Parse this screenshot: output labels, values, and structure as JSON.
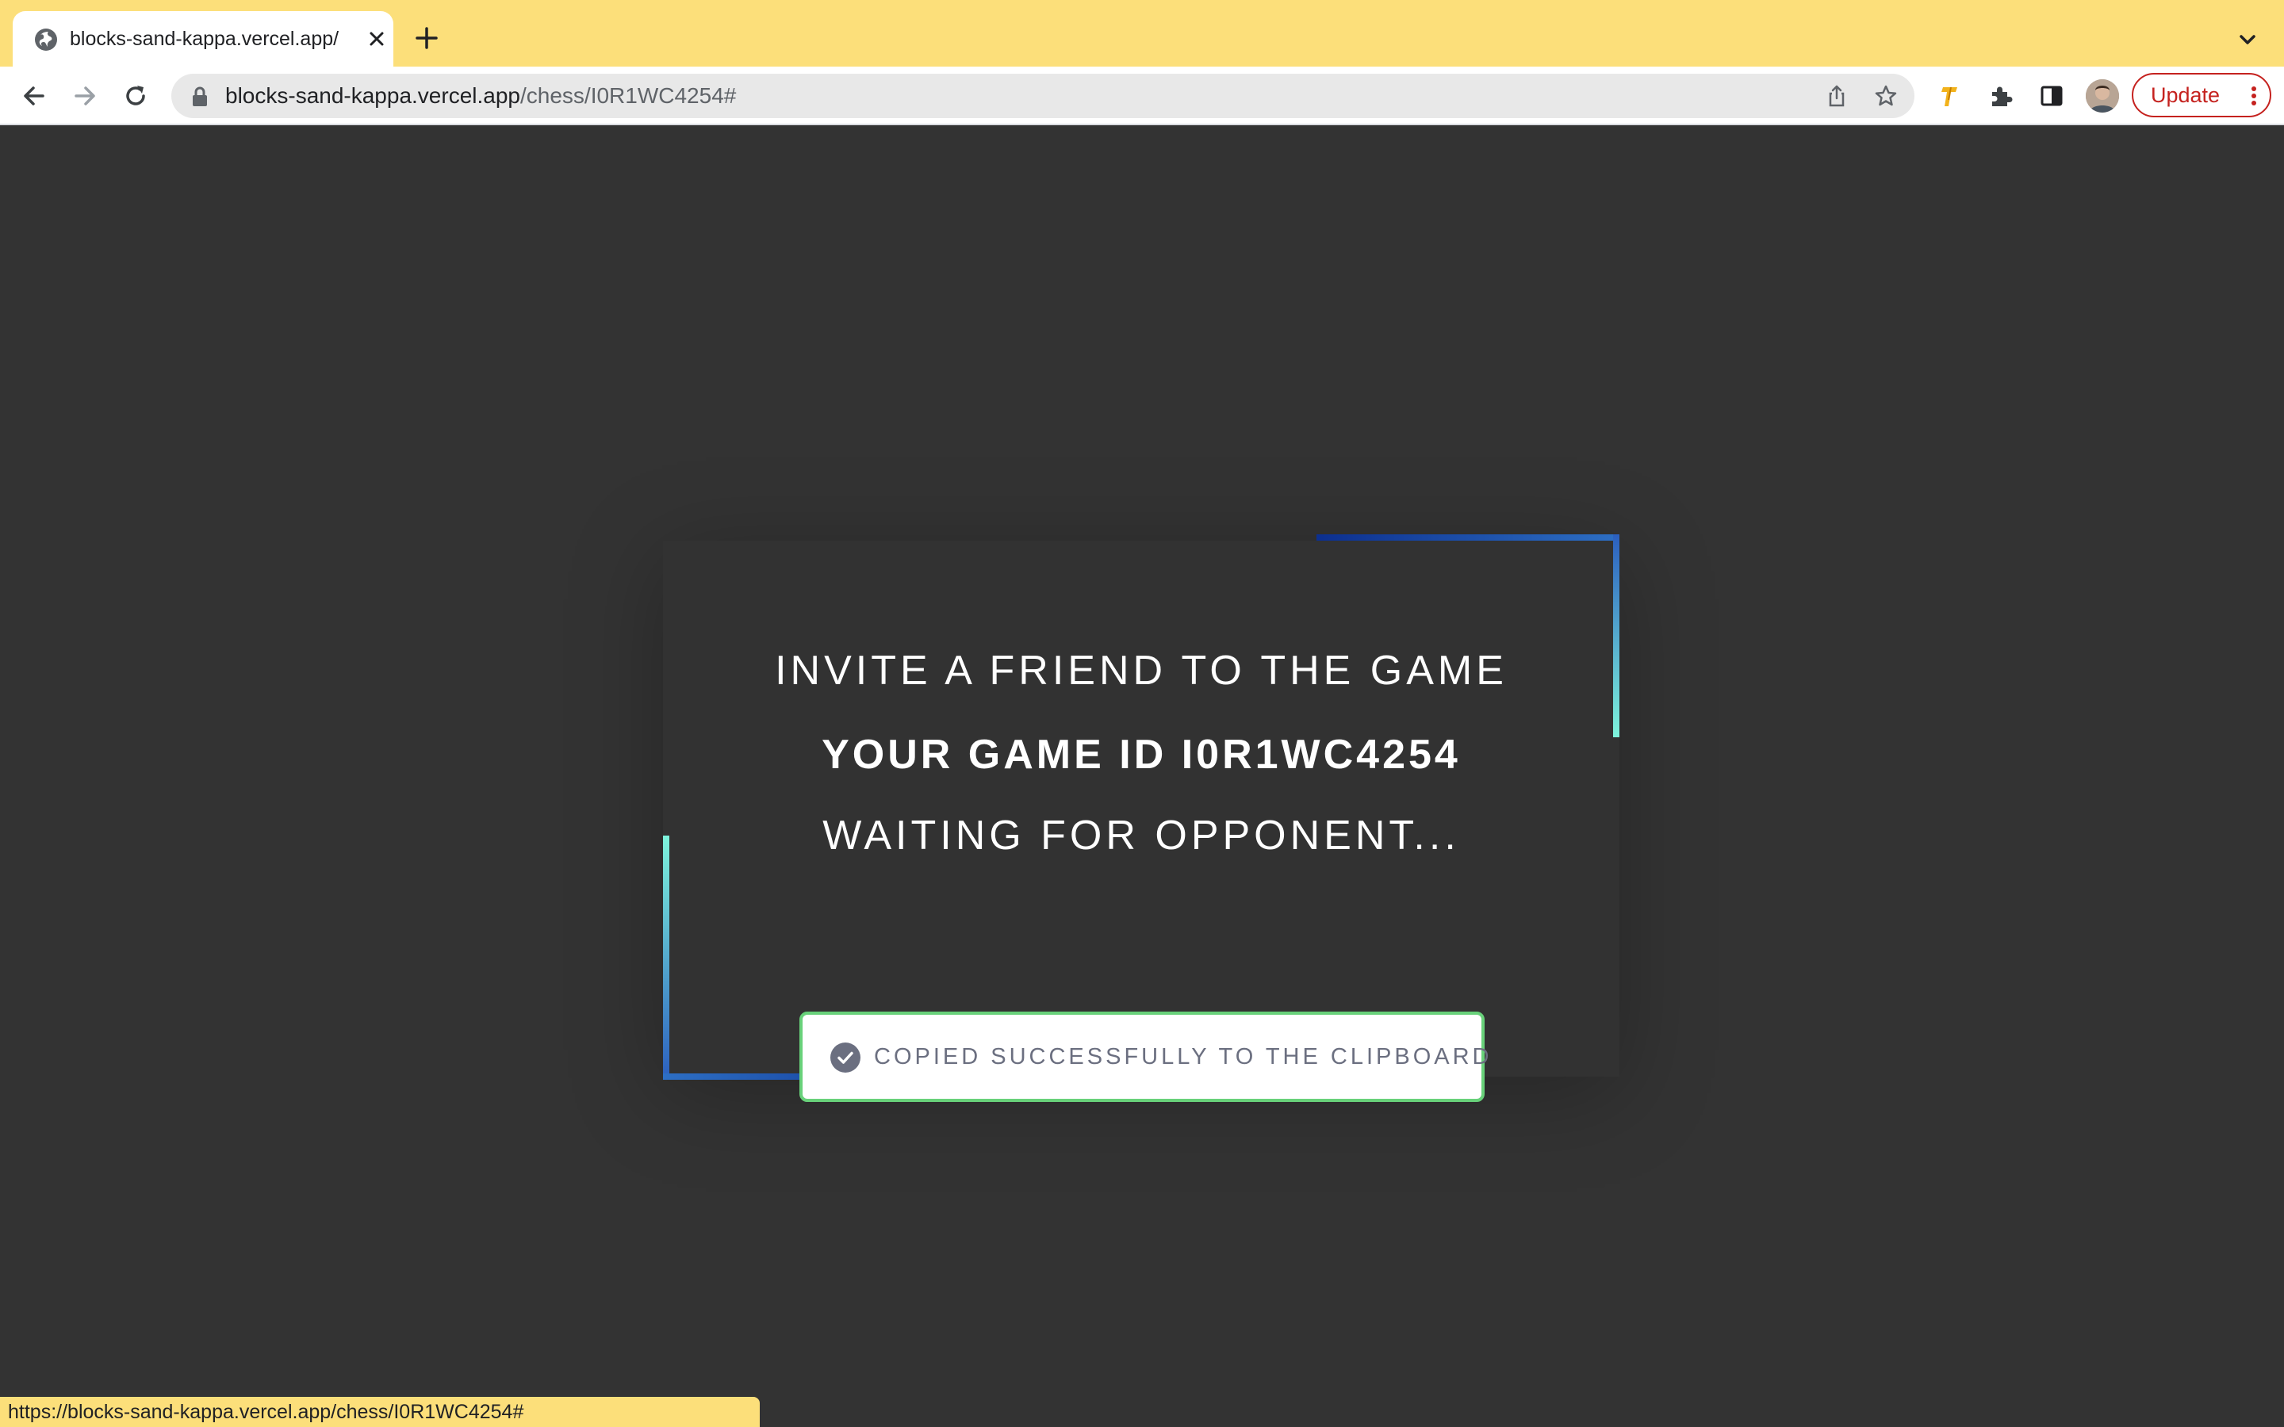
{
  "browser": {
    "tab": {
      "title": "blocks-sand-kappa.vercel.app/",
      "favicon": "globe-icon"
    },
    "omnibox": {
      "host": "blocks-sand-kappa.vercel.app",
      "path": "/chess/I0R1WC4254#"
    },
    "update_label": "Update",
    "status_url": "https://blocks-sand-kappa.vercel.app/chess/I0R1WC4254#",
    "theme_color": "#fcdf7a"
  },
  "invite": {
    "heading": "INVITE A FRIEND TO THE GAME",
    "game_id_text": "YOUR GAME ID I0R1WC4254",
    "waiting_text": "WAITING FOR OPPONENT...",
    "toast_text": "COPIED SUCCESSFULLY TO THE CLIPBOARD",
    "toast_border_color": "#68d17a",
    "accent_colors": [
      "#0c2f8f",
      "#7ef4dc"
    ]
  }
}
